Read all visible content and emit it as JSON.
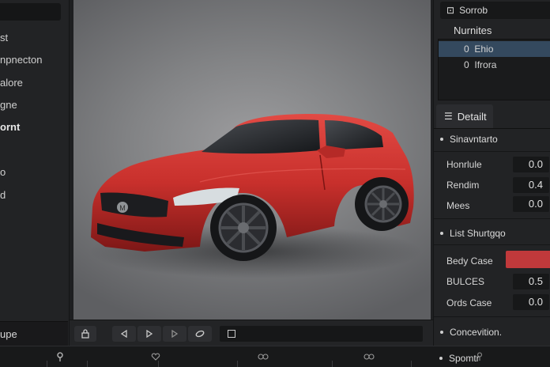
{
  "left_panel": {
    "items": [
      {
        "label": "st"
      },
      {
        "label": "npnecton"
      },
      {
        "label": "alore"
      },
      {
        "label": "gne"
      },
      {
        "label": "ornt"
      },
      {
        "label": "o"
      },
      {
        "label": "d"
      }
    ],
    "bottom_label": "upe"
  },
  "viewport": {
    "car_badge": "M",
    "car_color": "#c8302c"
  },
  "right_panel": {
    "search_label": "Sorrob",
    "section_title": "Nurnites",
    "list": [
      {
        "index": "0",
        "label": "Ehio",
        "selected": true
      },
      {
        "index": "0",
        "label": "Ifrora",
        "selected": false
      }
    ],
    "detail_tab": "Detailt",
    "group1": {
      "title": "Sinavntarto",
      "props": [
        {
          "label": "Honrlule",
          "value": "0.0"
        },
        {
          "label": "Rendim",
          "value": "0.4"
        },
        {
          "label": "Mees",
          "value": "0.0"
        }
      ]
    },
    "group2": {
      "title": "List Shurtgqo",
      "props": [
        {
          "label": "Bedy Case",
          "value": ""
        },
        {
          "label": "BULCES",
          "value": "0.5"
        },
        {
          "label": "Ords Case",
          "value": "0.0"
        }
      ],
      "swatch_color": "#c0393b"
    },
    "group3": {
      "title": "Concevition."
    },
    "group4": {
      "title": "Spomtr"
    }
  },
  "transport": {
    "buttons": [
      "lock",
      "prev",
      "play",
      "next",
      "loop"
    ]
  },
  "timeline": {
    "markers": [
      "marker-pin",
      "heart",
      "infinity",
      "infinity"
    ]
  }
}
